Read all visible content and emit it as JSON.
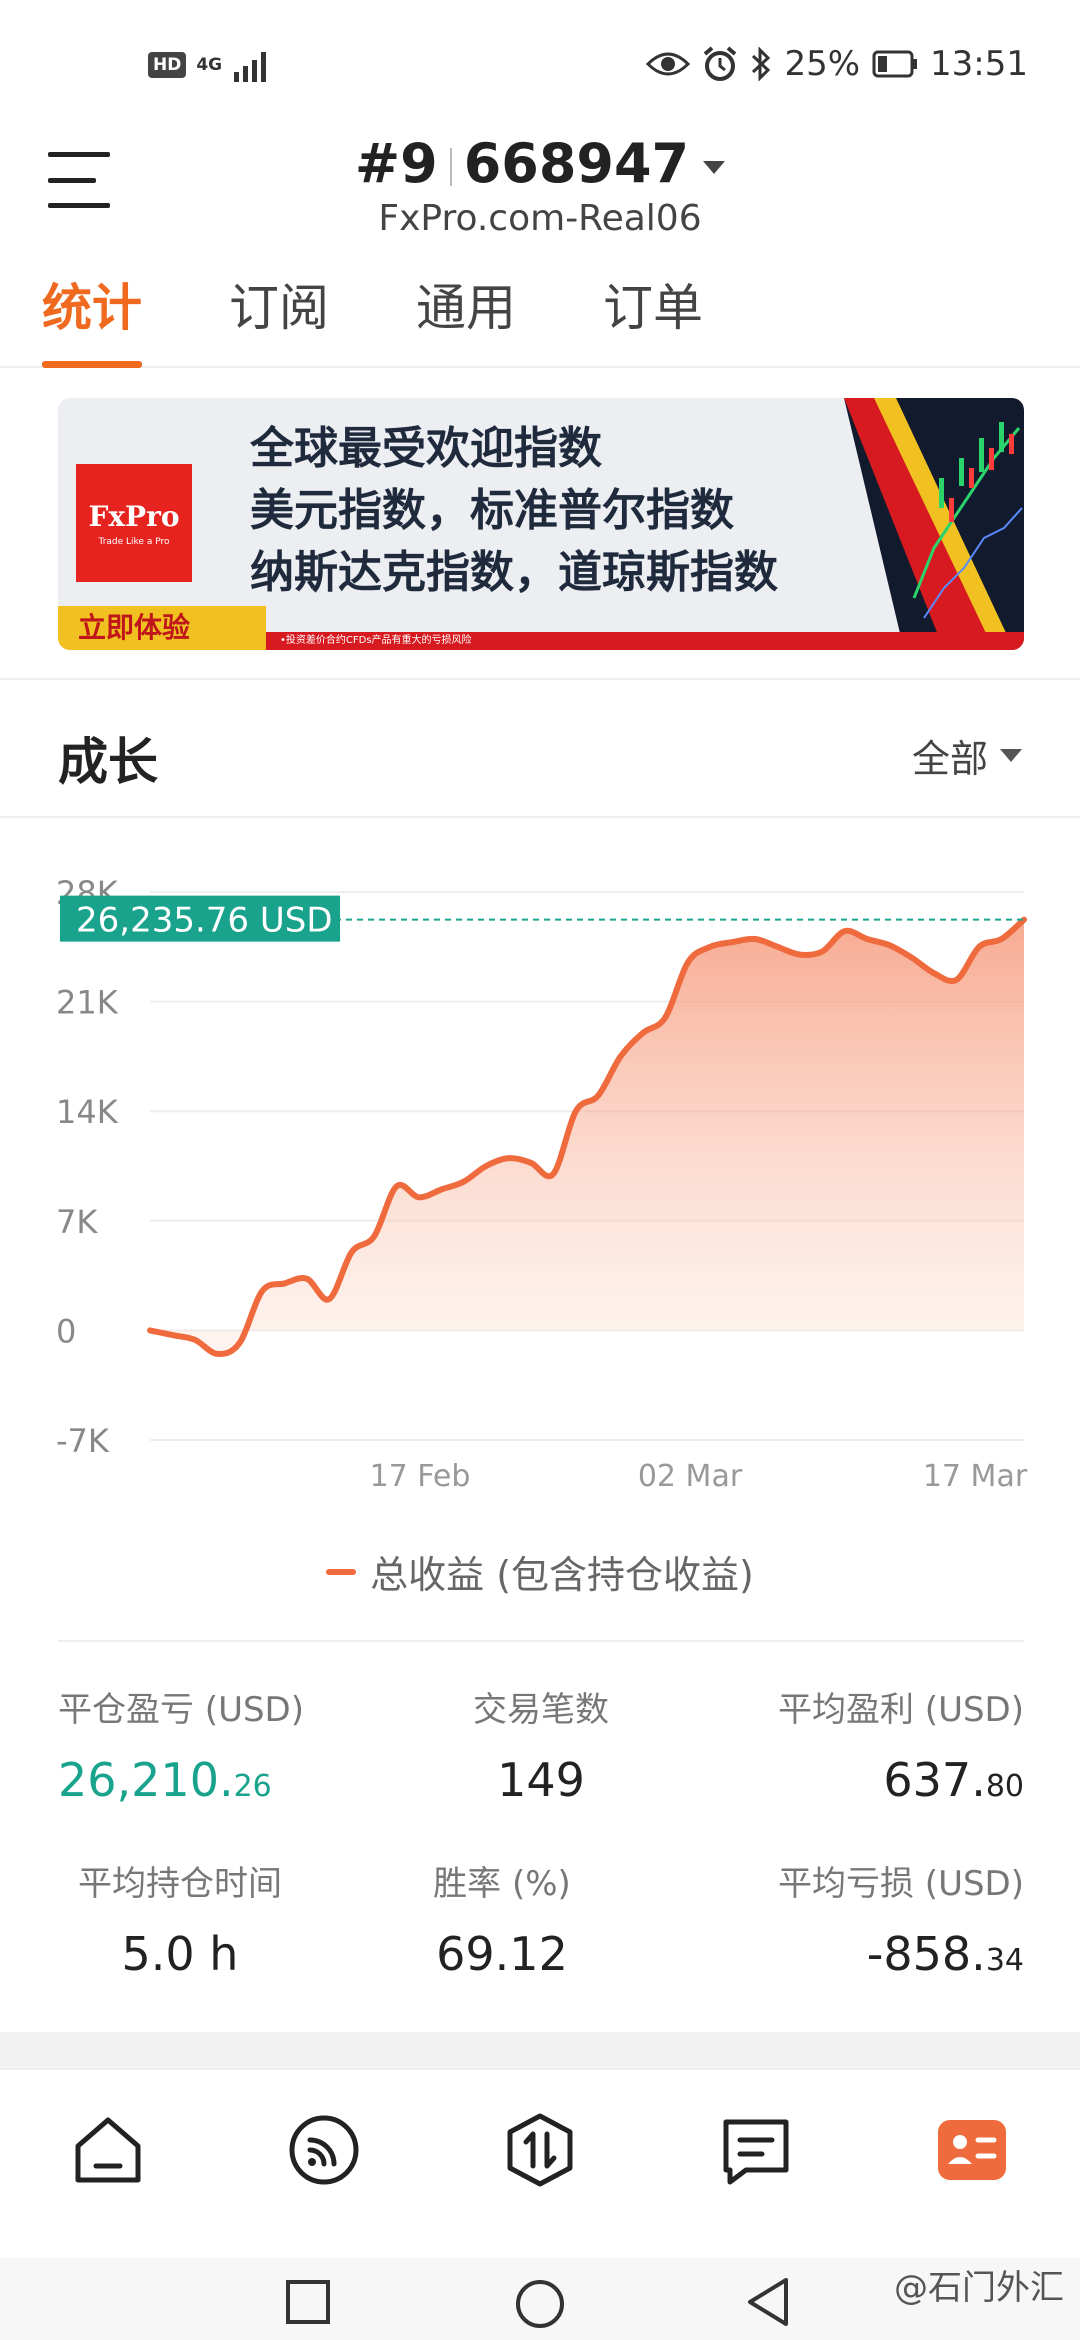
{
  "status_bar": {
    "hd": "HD",
    "network": "4G",
    "battery": "25%",
    "time": "13:51"
  },
  "header": {
    "account_number": "#9",
    "account_id": "668947",
    "server": "FxPro.com-Real06"
  },
  "tabs": [
    {
      "label": "统计",
      "active": true
    },
    {
      "label": "订阅",
      "active": false
    },
    {
      "label": "通用",
      "active": false
    },
    {
      "label": "订单",
      "active": false
    }
  ],
  "banner": {
    "logo_main": "FxPro",
    "logo_sub": "Trade Like a Pro",
    "line1": "全球最受欢迎指数",
    "line2": "美元指数，标准普尔指数",
    "line3": "纳斯达克指数，道琼斯指数",
    "cta": "立即体验",
    "disclaimer": "•投资差价合约CFDs产品有重大的亏损风险"
  },
  "growth": {
    "title": "成长",
    "period": "全部"
  },
  "chart_data": {
    "type": "area",
    "y_ticks": [
      "28K",
      "21K",
      "14K",
      "7K",
      "0",
      "-7K"
    ],
    "y_tick_values": [
      28000,
      21000,
      14000,
      7000,
      0,
      -7000
    ],
    "x_ticks": [
      "17 Feb",
      "02 Mar",
      "17 Mar"
    ],
    "ylim": [
      -7000,
      28000
    ],
    "current_label": "26,235.76 USD",
    "current_value": 26235.76,
    "series": [
      {
        "name": "总收益 (包含持仓收益)",
        "color": "#ef6a3d",
        "values": [
          0,
          -300,
          -600,
          -1500,
          -800,
          2500,
          3000,
          3300,
          2000,
          5000,
          6000,
          9200,
          8500,
          9000,
          9500,
          10500,
          11000,
          10700,
          10000,
          14000,
          15000,
          17500,
          19000,
          20000,
          23500,
          24500,
          24800,
          25000,
          24500,
          24000,
          24200,
          25500,
          25000,
          24600,
          23800,
          22800,
          22400,
          24500,
          25000,
          26235.76
        ]
      }
    ]
  },
  "legend_label": "总收益 (包含持仓收益)",
  "stats": {
    "closed_pnl_label": "平仓盈亏 (USD)",
    "closed_pnl_int": "26,210.",
    "closed_pnl_dec": "26",
    "trades_label": "交易笔数",
    "trades_value": "149",
    "avg_profit_label": "平均盈利 (USD)",
    "avg_profit_int": "637.",
    "avg_profit_dec": "80",
    "avg_hold_label": "平均持仓时间",
    "avg_hold_value": "5.0 h",
    "win_rate_label": "胜率 (%)",
    "win_rate_value": "69.12",
    "avg_loss_label": "平均亏损 (USD)",
    "avg_loss_int": "-858.",
    "avg_loss_dec": "34"
  },
  "watermark": "@石门外汇"
}
